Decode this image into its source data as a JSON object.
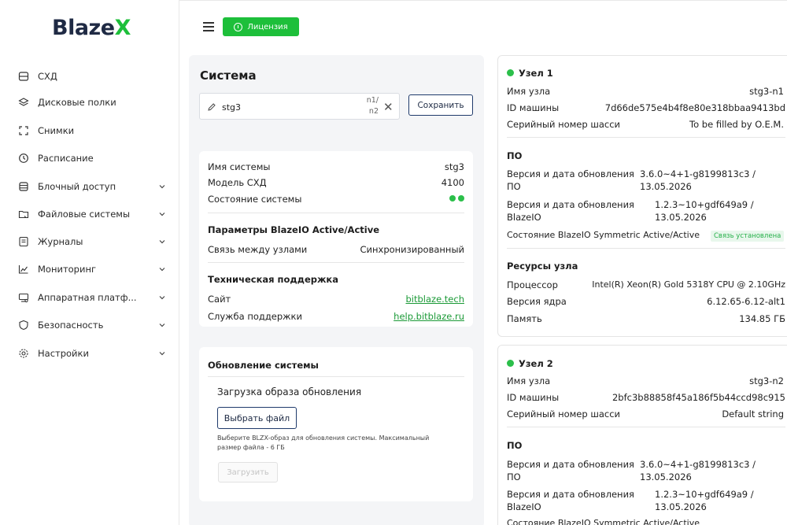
{
  "brand": {
    "name_main": "Blaze",
    "name_accent": "X"
  },
  "colors": {
    "accent": "#1dbf3a",
    "navy": "#1f3a6b"
  },
  "header": {
    "license_label": "Лицензия"
  },
  "sidebar": {
    "items": [
      {
        "label": "СХД",
        "icon": "storage-icon"
      },
      {
        "label": "Дисковые полки",
        "icon": "layers-icon"
      },
      {
        "label": "Снимки",
        "icon": "snapshot-icon"
      },
      {
        "label": "Расписание",
        "icon": "clock-icon"
      },
      {
        "label": "Блочный доступ",
        "icon": "database-icon"
      },
      {
        "label": "Файловые системы",
        "icon": "folder-icon"
      },
      {
        "label": "Журналы",
        "icon": "log-icon"
      },
      {
        "label": "Мониторинг",
        "icon": "chart-icon"
      },
      {
        "label": "Аппаратная платф...",
        "icon": "hardware-icon"
      },
      {
        "label": "Безопасность",
        "icon": "shield-icon"
      },
      {
        "label": "Настройки",
        "icon": "gear-icon"
      }
    ]
  },
  "system": {
    "title": "Система",
    "name_value": "stg3",
    "nodes_label_1": "n1/",
    "nodes_label_2": "n2",
    "save_label": "Сохранить",
    "info": {
      "name_label": "Имя системы",
      "name_value": "stg3",
      "model_label": "Модель СХД",
      "model_value": "4100",
      "state_label": "Состояние системы"
    },
    "params": {
      "title": "Параметры BlazeIO Active/Active",
      "link_label": "Связь между узлами",
      "link_value": "Синхронизированный"
    },
    "support": {
      "title": "Техническая поддержка",
      "site_label": "Сайт",
      "site_value": "bitblaze.tech",
      "service_label": "Служба поддержки",
      "service_value": "help.bitblaze.ru"
    },
    "update": {
      "title": "Обновление системы",
      "upload_title": "Загрузка образа обновления",
      "choose_label": "Выбрать файл",
      "hint_line1": "Выберите BLZX-образ для обновления системы. Максимальный",
      "hint_line2": "размер файла - 6 ГБ",
      "upload_label": "Загрузить"
    }
  },
  "node1": {
    "title": "Узел 1",
    "host_label": "Имя узла",
    "host_value": "stg3-n1",
    "id_label": "ID машины",
    "id_value": "7d66de575e4b4f8e80e318bbaa9413bd",
    "serial_label": "Серийный номер шасси",
    "serial_value": "To be filled by O.E.M.",
    "po_title": "ПО",
    "po_ver_label_1": "Версия и дата обновления",
    "po_ver_label_2": "ПО",
    "po_ver_value_1": "3.6.0~4+1-g8199813c3 /",
    "po_ver_value_2": "13.05.2026",
    "bio_ver_label_1": "Версия и дата обновления",
    "bio_ver_label_2": "BlazeIO",
    "bio_ver_value_1": "1.2.3~10+gdf649a9 /",
    "bio_ver_value_2": "13.05.2026",
    "bio_state_label": "Состояние BlazeIO Symmetric Active/Active",
    "bio_state_value": "Связь установлена",
    "res_title": "Ресурсы узла",
    "cpu_label": "Процессор",
    "cpu_value": "Intel(R) Xeon(R) Gold 5318Y CPU @ 2.10GHz",
    "kernel_label": "Версия ядра",
    "kernel_value": "6.12.65-6.12-alt1",
    "mem_label": "Память",
    "mem_value": "134.85 ГБ"
  },
  "node2": {
    "title": "Узел 2",
    "host_label": "Имя узла",
    "host_value": "stg3-n2",
    "id_label": "ID машины",
    "id_value": "2bfc3b88858f45a186f5b44ccd98c915",
    "serial_label": "Серийный номер шасси",
    "serial_value": "Default string",
    "po_title": "ПО",
    "po_ver_label_1": "Версия и дата обновления",
    "po_ver_label_2": "ПО",
    "po_ver_value_1": "3.6.0~4+1-g8199813c3 /",
    "po_ver_value_2": "13.05.2026",
    "bio_ver_label_1": "Версия и дата обновления",
    "bio_ver_label_2": "BlazeIO",
    "bio_ver_value_1": "1.2.3~10+gdf649a9 /",
    "bio_ver_value_2": "13.05.2026",
    "bio_state_label": "Состояние BlazeIO Symmetric Active/Active"
  }
}
